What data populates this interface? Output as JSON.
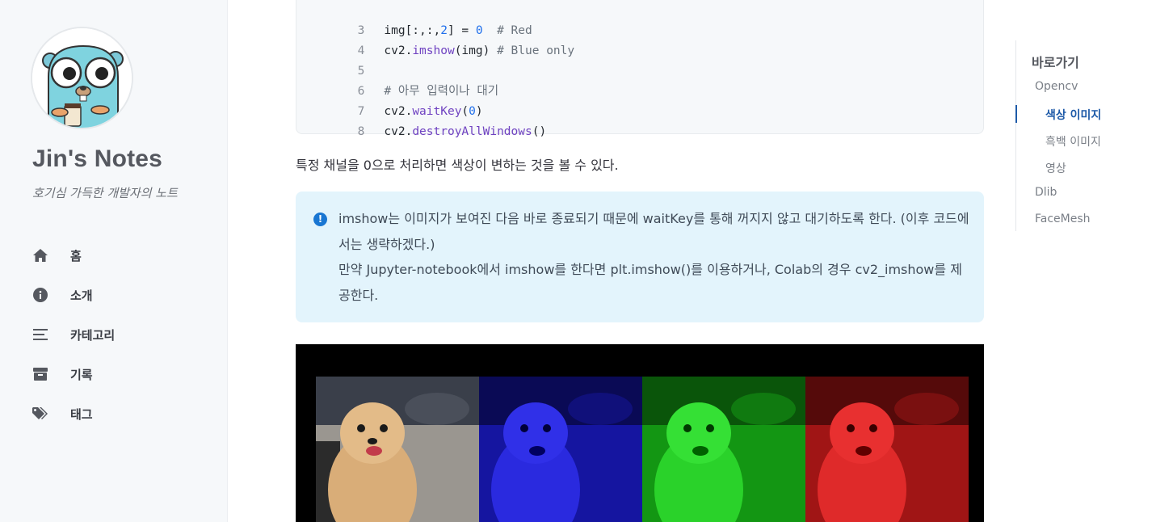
{
  "sidebar": {
    "title": "Jin's Notes",
    "subtitle": "호기심 가득한 개발자의 노트",
    "nav": [
      {
        "label": "홈",
        "icon": "home-icon"
      },
      {
        "label": "소개",
        "icon": "info-icon"
      },
      {
        "label": "카테고리",
        "icon": "list-icon"
      },
      {
        "label": "기록",
        "icon": "archive-icon"
      },
      {
        "label": "태그",
        "icon": "tags-icon"
      }
    ]
  },
  "code": {
    "lines": [
      {
        "num": "3",
        "a": "img[:,:,",
        "b": "2",
        "c": "] = ",
        "d": "0",
        "e": "  # Red"
      },
      {
        "num": "4",
        "a": "cv2.",
        "fn": "imshow",
        "rest": "(img) ",
        "cmt": "# Blue only"
      },
      {
        "num": "5"
      },
      {
        "num": "6",
        "cmt": "# 아무 입력이나 대기"
      },
      {
        "num": "7",
        "a": "cv2.",
        "fn": "waitKey",
        "rest": "(",
        "n": "0",
        "end": ")"
      },
      {
        "num": "8",
        "a": "cv2.",
        "fn": "destroyAllWindows",
        "rest": "()"
      }
    ]
  },
  "paragraph": "특정 채널을 0으로 처리하면 색상이 변하는 것을 볼 수 있다.",
  "notice": {
    "line1": "imshow는 이미지가 보여진 다음 바로 종료되기 때문에 waitKey를 통해 꺼지지 않고 대기하도록 한다. (이후 코드에서는 생략하겠다.)",
    "line2": "만약 Jupyter-notebook에서 imshow를 한다면 plt.imshow()를 이용하거나, Colab의 경우 cv2_imshow를 제공한다."
  },
  "toc": {
    "title": "바로가기",
    "items": [
      {
        "label": "Opencv",
        "level": 1
      },
      {
        "label": "색상 이미지",
        "level": 2,
        "active": true
      },
      {
        "label": "흑백 이미지",
        "level": 2
      },
      {
        "label": "영상",
        "level": 2
      },
      {
        "label": "Dlib",
        "level": 1
      },
      {
        "label": "FaceMesh",
        "level": 1
      }
    ]
  },
  "colors": {
    "accent": "#1e5aa8",
    "notice_bg": "#e3f4fc",
    "sidebar_bg": "#f6f8fa"
  }
}
